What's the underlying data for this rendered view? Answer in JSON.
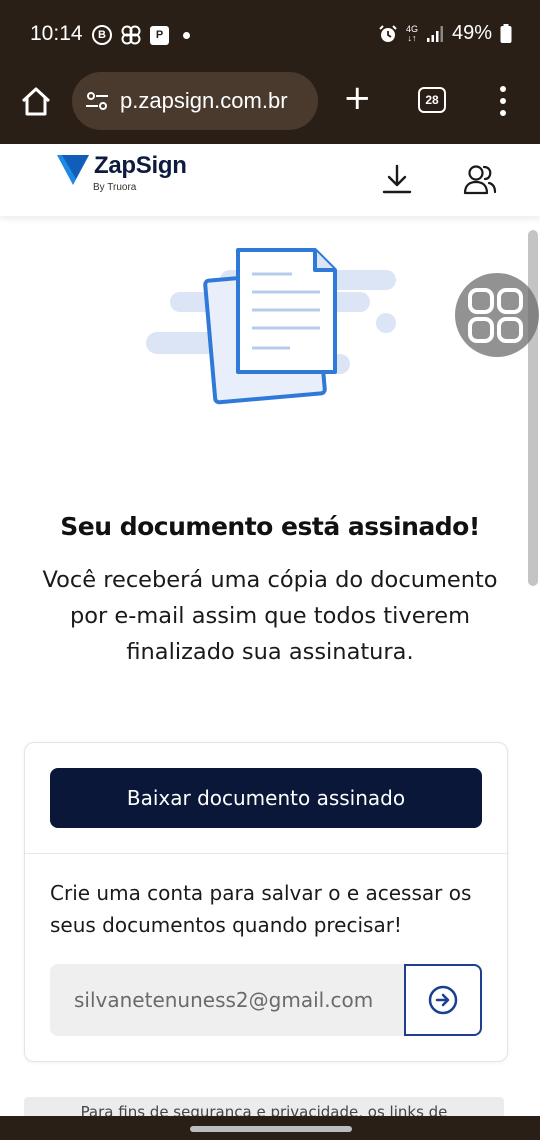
{
  "status_bar": {
    "time": "10:14",
    "left_icons": [
      "b-circle-icon",
      "pinwheel-icon",
      "p-badge-icon",
      "dot-icon"
    ],
    "b_label": "B",
    "p_label": "P",
    "network": "4G",
    "battery": "49%"
  },
  "browser": {
    "url": "p.zapsign.com.br",
    "tab_count": "28"
  },
  "app_header": {
    "brand": "ZapSign",
    "brand_sub": "By Truora"
  },
  "main": {
    "title": "Seu documento está assinado!",
    "message": "Você receberá uma cópia do documento por e-mail assim que todos tiverem finalizado sua assinatura."
  },
  "card": {
    "download_label": "Baixar documento assinado",
    "create_account_text": "Crie uma conta para salvar o e acessar os seus documentos quando precisar!",
    "email_value": "silvanetenuness2@gmail.com"
  },
  "footer": {
    "note": "Para fins de segurança e privacidade, os links de"
  },
  "colors": {
    "primary": "#0b1739",
    "accent": "#1d3f8f",
    "illustration_blue": "#2f7ad8",
    "illustration_light": "#dbe5f5",
    "system_bar": "#2a1f17"
  }
}
